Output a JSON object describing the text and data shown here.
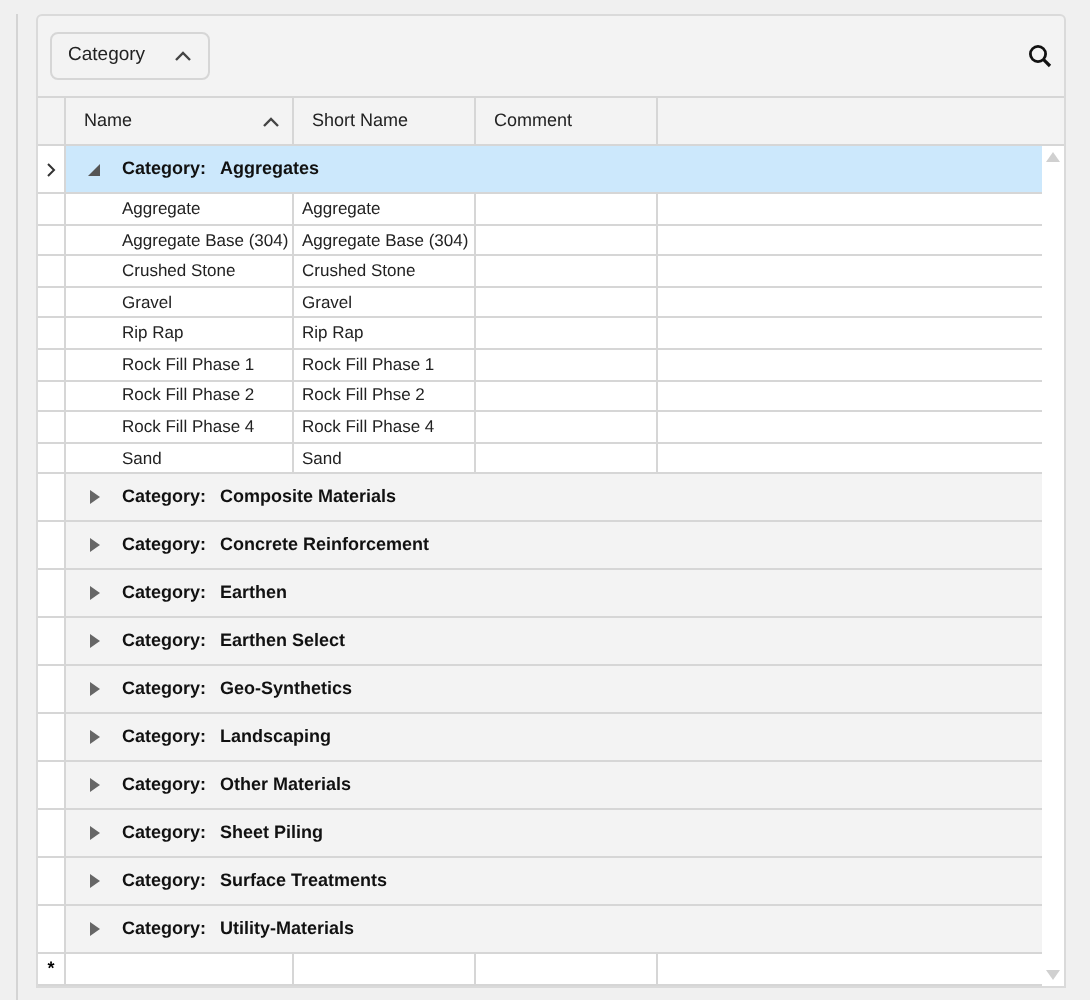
{
  "group_panel": {
    "chips": [
      {
        "label": "Category",
        "sorted": true
      }
    ]
  },
  "columns": [
    {
      "label": "Name",
      "sorted": true
    },
    {
      "label": "Short Name",
      "sorted": false
    },
    {
      "label": "Comment",
      "sorted": false
    }
  ],
  "groups": [
    {
      "label": "Category:",
      "value": "Aggregates",
      "expanded": true,
      "selected": true,
      "rows": [
        {
          "cells": [
            "Aggregate",
            "Aggregate"
          ]
        },
        {
          "cells": [
            "Aggregate Base (304)",
            "Aggregate Base (304)"
          ]
        },
        {
          "cells": [
            "Crushed Stone",
            "Crushed Stone"
          ]
        },
        {
          "cells": [
            "Gravel",
            "Gravel"
          ]
        },
        {
          "cells": [
            "Rip Rap",
            "Rip Rap"
          ]
        },
        {
          "cells": [
            "Rock Fill Phase 1",
            "Rock Fill Phase 1"
          ]
        },
        {
          "cells": [
            "Rock Fill Phase 2",
            "Rock Fill Phse 2"
          ]
        },
        {
          "cells": [
            "Rock Fill Phase 4",
            "Rock Fill Phase 4"
          ]
        },
        {
          "cells": [
            "Sand",
            "Sand"
          ]
        }
      ]
    },
    {
      "label": "Category:",
      "value": "Composite Materials",
      "expanded": false,
      "selected": false
    },
    {
      "label": "Category:",
      "value": "Concrete Reinforcement",
      "expanded": false,
      "selected": false
    },
    {
      "label": "Category:",
      "value": "Earthen",
      "expanded": false,
      "selected": false
    },
    {
      "label": "Category:",
      "value": "Earthen Select",
      "expanded": false,
      "selected": false
    },
    {
      "label": "Category:",
      "value": "Geo-Synthetics",
      "expanded": false,
      "selected": false
    },
    {
      "label": "Category:",
      "value": "Landscaping",
      "expanded": false,
      "selected": false
    },
    {
      "label": "Category:",
      "value": "Other Materials",
      "expanded": false,
      "selected": false
    },
    {
      "label": "Category:",
      "value": "Sheet Piling",
      "expanded": false,
      "selected": false
    },
    {
      "label": "Category:",
      "value": "Surface Treatments",
      "expanded": false,
      "selected": false
    },
    {
      "label": "Category:",
      "value": "Utility-Materials",
      "expanded": false,
      "selected": false
    }
  ],
  "new_row": {
    "marker": "*"
  }
}
